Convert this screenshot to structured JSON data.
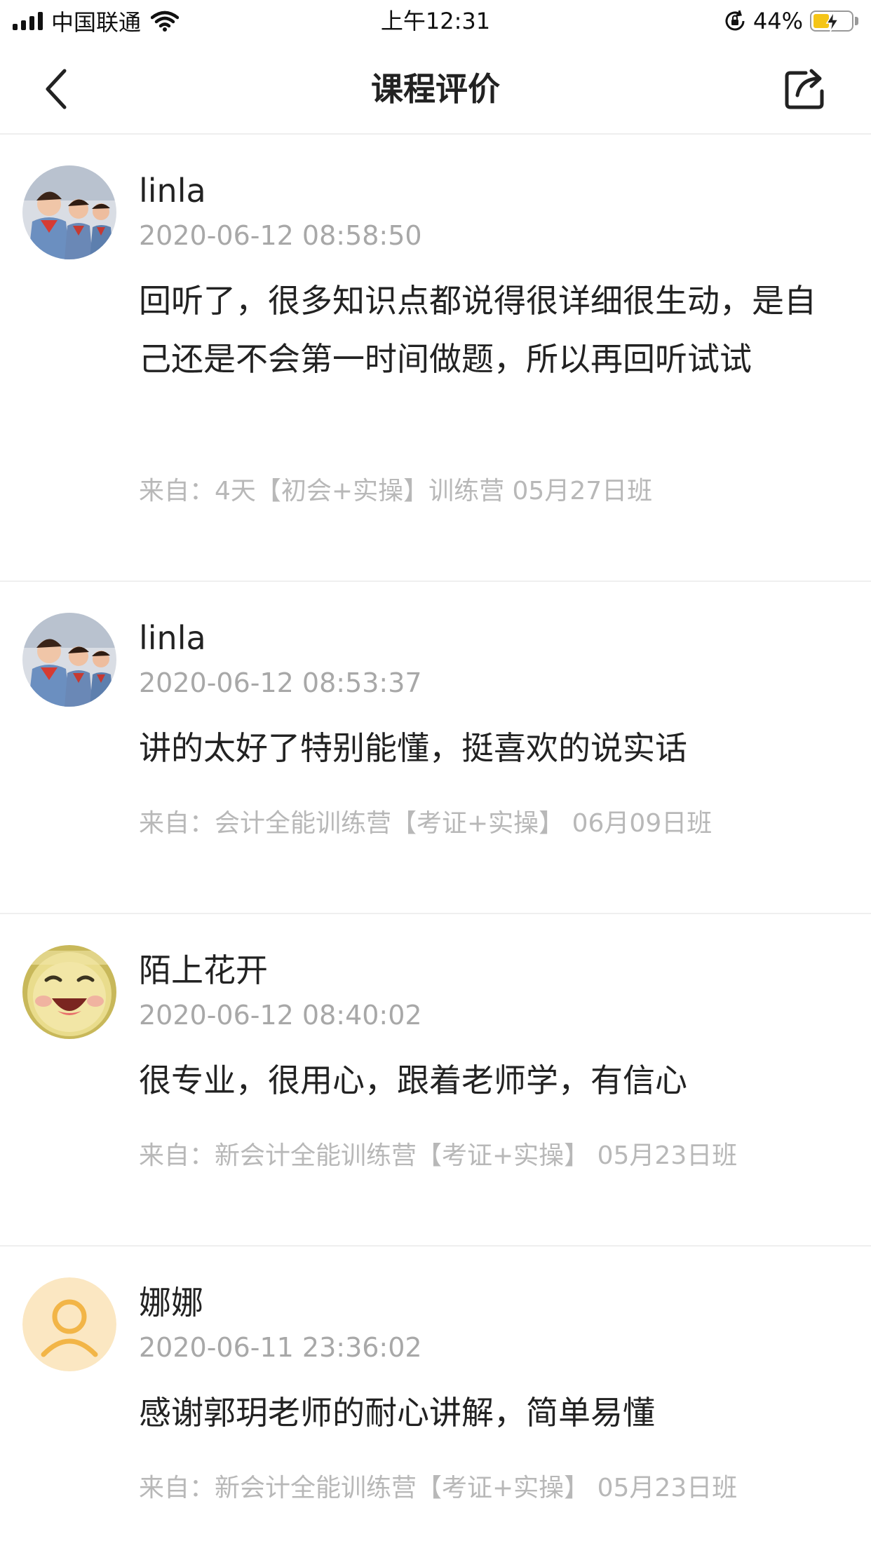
{
  "status_bar": {
    "carrier": "中国联通",
    "time": "上午12:31",
    "battery": "44%",
    "battery_level": 0.44,
    "icons": [
      "signal-icon",
      "wifi-icon",
      "orientation-lock-icon",
      "battery-icon"
    ]
  },
  "nav": {
    "title": "课程评价",
    "back_icon": "chevron-left-icon",
    "share_icon": "share-icon"
  },
  "reviews": [
    {
      "username": "linla",
      "time": "2020-06-12 08:58:50",
      "content": "回听了，很多知识点都说得很详细很生动，是自己还是不会第一时间做题，所以再回听试试",
      "source": "来自：4天【初会+实操】训练营 05月27日班"
    },
    {
      "username": "linla",
      "time": "2020-06-12 08:53:37",
      "content": "讲的太好了特别能懂，挺喜欢的说实话",
      "source": "来自：会计全能训练营【考证+实操】 06月09日班"
    },
    {
      "username": "陌上花开",
      "time": "2020-06-12 08:40:02",
      "content": "很专业，很用心，跟着老师学，有信心",
      "source": "来自：新会计全能训练营【考证+实操】 05月23日班"
    },
    {
      "username": "娜娜",
      "time": "2020-06-11 23:36:02",
      "content": "感谢郭玥老师的耐心讲解，简单易懂",
      "source": "来自：新会计全能训练营【考证+实操】 05月23日班"
    }
  ],
  "colors": {
    "text": "#222222",
    "meta": "#a8a8a8",
    "source": "#b8b8b8",
    "divider": "#efefef",
    "battery_fill": "#f5c518",
    "avatar_default_bg": "#fbe7c2",
    "avatar_default_fg": "#f2b547"
  }
}
